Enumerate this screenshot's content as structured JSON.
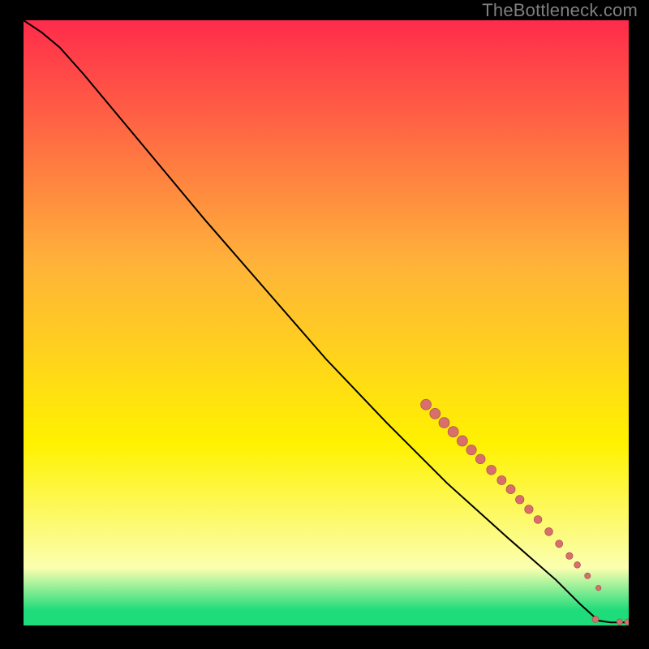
{
  "watermark": "TheBottleneck.com",
  "colors": {
    "bg": "#000000",
    "watermark": "#7f7f7f",
    "curve": "#000000",
    "dot_fill": "#d86f6b",
    "dot_stroke": "#a7514e",
    "gradient_top": "#ff2b4b",
    "gradient_mid_upper": "#ffb23a",
    "gradient_mid": "#fff200",
    "gradient_lower": "#fbffb0",
    "gradient_bottom": "#1fdc7a"
  },
  "chart_data": {
    "type": "line",
    "xlabel": "",
    "ylabel": "",
    "title": "",
    "xlim": [
      0,
      100
    ],
    "ylim": [
      0,
      100
    ],
    "curve": [
      {
        "x": 0,
        "y": 100
      },
      {
        "x": 3,
        "y": 98
      },
      {
        "x": 6,
        "y": 95.5
      },
      {
        "x": 10,
        "y": 91
      },
      {
        "x": 20,
        "y": 79
      },
      {
        "x": 30,
        "y": 67
      },
      {
        "x": 40,
        "y": 55.5
      },
      {
        "x": 50,
        "y": 44
      },
      {
        "x": 60,
        "y": 33.5
      },
      {
        "x": 70,
        "y": 23.5
      },
      {
        "x": 80,
        "y": 14.5
      },
      {
        "x": 88,
        "y": 7.5
      },
      {
        "x": 92,
        "y": 3.5
      },
      {
        "x": 95,
        "y": 0.8
      },
      {
        "x": 97,
        "y": 0.5
      },
      {
        "x": 100,
        "y": 0.5
      }
    ],
    "points": [
      {
        "x": 66.5,
        "y": 36.5,
        "r": 1.0
      },
      {
        "x": 68.0,
        "y": 35.0,
        "r": 1.0
      },
      {
        "x": 69.5,
        "y": 33.5,
        "r": 1.0
      },
      {
        "x": 71.0,
        "y": 32.0,
        "r": 1.0
      },
      {
        "x": 72.5,
        "y": 30.5,
        "r": 1.0
      },
      {
        "x": 74.0,
        "y": 29.0,
        "r": 0.95
      },
      {
        "x": 75.5,
        "y": 27.5,
        "r": 0.9
      },
      {
        "x": 77.3,
        "y": 25.7,
        "r": 0.9
      },
      {
        "x": 79.0,
        "y": 24.0,
        "r": 0.85
      },
      {
        "x": 80.5,
        "y": 22.5,
        "r": 0.85
      },
      {
        "x": 82.0,
        "y": 20.8,
        "r": 0.8
      },
      {
        "x": 83.5,
        "y": 19.2,
        "r": 0.8
      },
      {
        "x": 85.0,
        "y": 17.5,
        "r": 0.75
      },
      {
        "x": 86.8,
        "y": 15.5,
        "r": 0.75
      },
      {
        "x": 88.5,
        "y": 13.5,
        "r": 0.7
      },
      {
        "x": 90.2,
        "y": 11.5,
        "r": 0.65
      },
      {
        "x": 91.5,
        "y": 10.0,
        "r": 0.6
      },
      {
        "x": 93.2,
        "y": 8.2,
        "r": 0.55
      },
      {
        "x": 95.0,
        "y": 6.2,
        "r": 0.5
      },
      {
        "x": 94.5,
        "y": 1.0,
        "r": 0.6
      },
      {
        "x": 98.5,
        "y": 0.6,
        "r": 0.55
      },
      {
        "x": 99.8,
        "y": 0.6,
        "r": 0.55
      }
    ],
    "gradient_stops": [
      {
        "offset": 0.0,
        "color_key": "gradient_top"
      },
      {
        "offset": 0.4,
        "color_key": "gradient_mid_upper"
      },
      {
        "offset": 0.7,
        "color_key": "gradient_mid"
      },
      {
        "offset": 0.905,
        "color_key": "gradient_lower"
      },
      {
        "offset": 0.975,
        "color_key": "gradient_bottom"
      },
      {
        "offset": 1.0,
        "color_key": "gradient_bottom"
      }
    ]
  }
}
